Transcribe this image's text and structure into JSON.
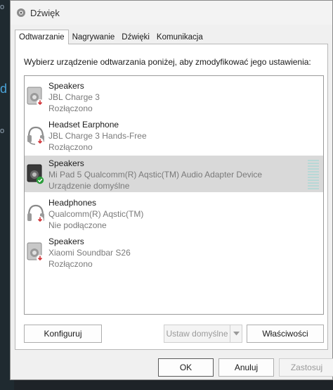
{
  "window": {
    "title": "Dźwięk"
  },
  "tabs": [
    {
      "label": "Odtwarzanie",
      "active": true
    },
    {
      "label": "Nagrywanie",
      "active": false
    },
    {
      "label": "Dźwięki",
      "active": false
    },
    {
      "label": "Komunikacja",
      "active": false
    }
  ],
  "instruction": "Wybierz urządzenie odtwarzania poniżej, aby zmodyfikować jego ustawienia:",
  "devices": [
    {
      "name": "Speakers",
      "description": "JBL Charge 3",
      "status": "Rozłączono",
      "icon": "speaker-icon",
      "badge": "disconnected"
    },
    {
      "name": "Headset Earphone",
      "description": "JBL Charge 3 Hands-Free",
      "status": "Rozłączono",
      "icon": "headset-icon",
      "badge": "disconnected"
    },
    {
      "name": "Speakers",
      "description": "Mi Pad 5 Qualcomm(R) Aqstic(TM) Audio Adapter Device",
      "status": "Urządzenie domyślne",
      "icon": "speaker-icon",
      "badge": "default",
      "selected": true
    },
    {
      "name": "Headphones",
      "description": "Qualcomm(R) Aqstic(TM)",
      "status": "Nie podłączone",
      "icon": "headphones-icon",
      "badge": "disconnected"
    },
    {
      "name": "Speakers",
      "description": "Xiaomi Soundbar S26",
      "status": "Rozłączono",
      "icon": "speaker-icon",
      "badge": "disconnected"
    }
  ],
  "buttons": {
    "configure": "Konfiguruj",
    "set_default": "Ustaw domyślne",
    "properties": "Właściwości",
    "ok": "OK",
    "cancel": "Anuluj",
    "apply": "Zastosuj"
  },
  "desktop": {
    "glyph_top": "o",
    "glyph_mid": "d",
    "glyph_low": "o"
  },
  "colors": {
    "disconnected_badge": "#d13438",
    "default_badge": "#2a9d3a",
    "level_meter": "#b7d8d6"
  }
}
